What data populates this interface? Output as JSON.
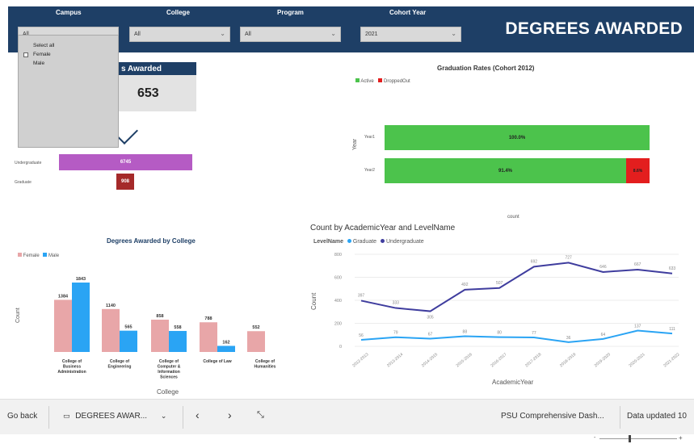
{
  "header": {
    "title": "DEGREES AWARDED",
    "filters": [
      {
        "label": "Campus",
        "value": "All"
      },
      {
        "label": "College",
        "value": "All"
      },
      {
        "label": "Program",
        "value": "All"
      },
      {
        "label": "Cohort Year",
        "value": "2021"
      }
    ]
  },
  "dropdown": {
    "items": [
      "Select all",
      "Female",
      "Male"
    ]
  },
  "card": {
    "title": "Degrees Awarded",
    "title_visible": "s Awarded",
    "value": "653"
  },
  "funnel": {
    "bars": [
      {
        "label": "Undergraduate",
        "value": "6745",
        "color": "#b55bc4"
      },
      {
        "label": "Graduate",
        "value": "908",
        "color": "#a52a2a"
      }
    ]
  },
  "grad_rates": {
    "title": "Graduation Rates (Cohort 2012)",
    "legend": [
      {
        "name": "Active",
        "color": "#4cc34c"
      },
      {
        "name": "DroppedOut",
        "color": "#e31e1e"
      }
    ],
    "ylabel": "Year",
    "xlabel": "count",
    "rows": [
      {
        "label": "Year1",
        "active": "100.0%",
        "dropped": ""
      },
      {
        "label": "Year2",
        "active": "91.4%",
        "dropped": "8.6%"
      }
    ]
  },
  "college_chart": {
    "title": "Degrees Awarded by College",
    "legend": [
      {
        "name": "Female",
        "color": "#e8a6a8"
      },
      {
        "name": "Male",
        "color": "#2aa4f4"
      }
    ],
    "ylabel": "Count",
    "xlabel": "College",
    "categories": [
      [
        "College of",
        "Business",
        "Administration"
      ],
      [
        "College of",
        "Engineering"
      ],
      [
        "College of",
        "Computer &",
        "Information",
        "Sciences"
      ],
      [
        "College of Law"
      ],
      [
        "College of",
        "Humanities"
      ]
    ],
    "female": [
      1384,
      1140,
      858,
      788,
      552
    ],
    "male": [
      1843,
      565,
      558,
      162,
      null
    ]
  },
  "line_chart": {
    "title": "Count by AcademicYear and LevelName",
    "legend_title": "LevelName",
    "legend": [
      {
        "name": "Graduate",
        "color": "#2aa4f4"
      },
      {
        "name": "Undergraduate",
        "color": "#3f3d9e"
      }
    ],
    "ylabel": "Count",
    "xlabel": "AcademicYear",
    "y_ticks": [
      "0",
      "200",
      "400",
      "600",
      "800"
    ],
    "x_labels": [
      "2012-2013",
      "2013-2014",
      "2014-2015",
      "2015-2016",
      "2016-2017",
      "2017-2018",
      "2018-2019",
      "2019-2020",
      "2020-2021",
      "2021-2022"
    ]
  },
  "chart_data": {
    "type": "line",
    "title": "Count by AcademicYear and LevelName",
    "x": [
      "2012-2013",
      "2013-2014",
      "2014-2015",
      "2015-2016",
      "2016-2017",
      "2017-2018",
      "2018-2019",
      "2019-2020",
      "2020-2021",
      "2021-2022"
    ],
    "series": [
      {
        "name": "Undergraduate",
        "values": [
          397,
          333,
          305,
          492,
          507,
          692,
          727,
          646,
          667,
          633
        ]
      },
      {
        "name": "Graduate",
        "values": [
          56,
          79,
          67,
          88,
          80,
          77,
          36,
          64,
          137,
          111
        ]
      }
    ],
    "xlabel": "AcademicYear",
    "ylabel": "Count",
    "ylim": [
      0,
      800
    ]
  },
  "footer": {
    "go_back": "Go back",
    "page_name": "DEGREES AWAR...",
    "report_name": "PSU Comprehensive Dash...",
    "updated": "Data updated 10"
  }
}
